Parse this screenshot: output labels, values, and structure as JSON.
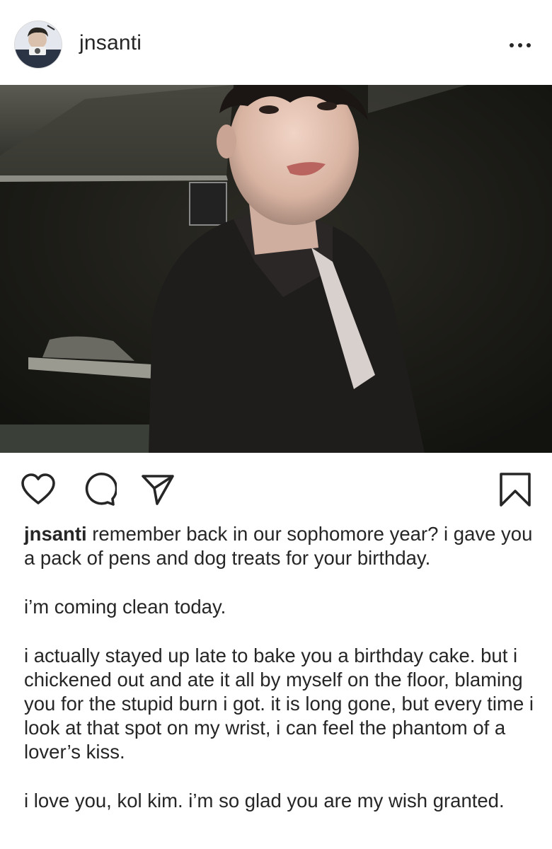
{
  "post": {
    "username": "jnsanti",
    "more_icon": "more-horizontal-icon",
    "photo_description_icon": "post-photo",
    "actions": {
      "like_icon": "heart-icon",
      "comment_icon": "comment-icon",
      "share_icon": "share-icon",
      "save_icon": "bookmark-icon"
    },
    "caption": {
      "username": "jnsanti",
      "paragraph_1": "remember back in our sophomore year? i gave you a pack of pens and dog treats for your birthday.",
      "paragraph_2": "i’m coming clean today.",
      "paragraph_3": "i actually stayed up late to bake you a birthday cake. but i chickened out and ate it all by myself on the floor, blaming you for the stupid burn i got. it is long gone, but every time i look at that spot on my wrist, i can feel the phantom of a lover’s kiss.",
      "paragraph_4": "i love you, kol kim. i’m so glad you are my wish granted."
    }
  },
  "colors": {
    "text": "#262626",
    "background": "#ffffff"
  }
}
